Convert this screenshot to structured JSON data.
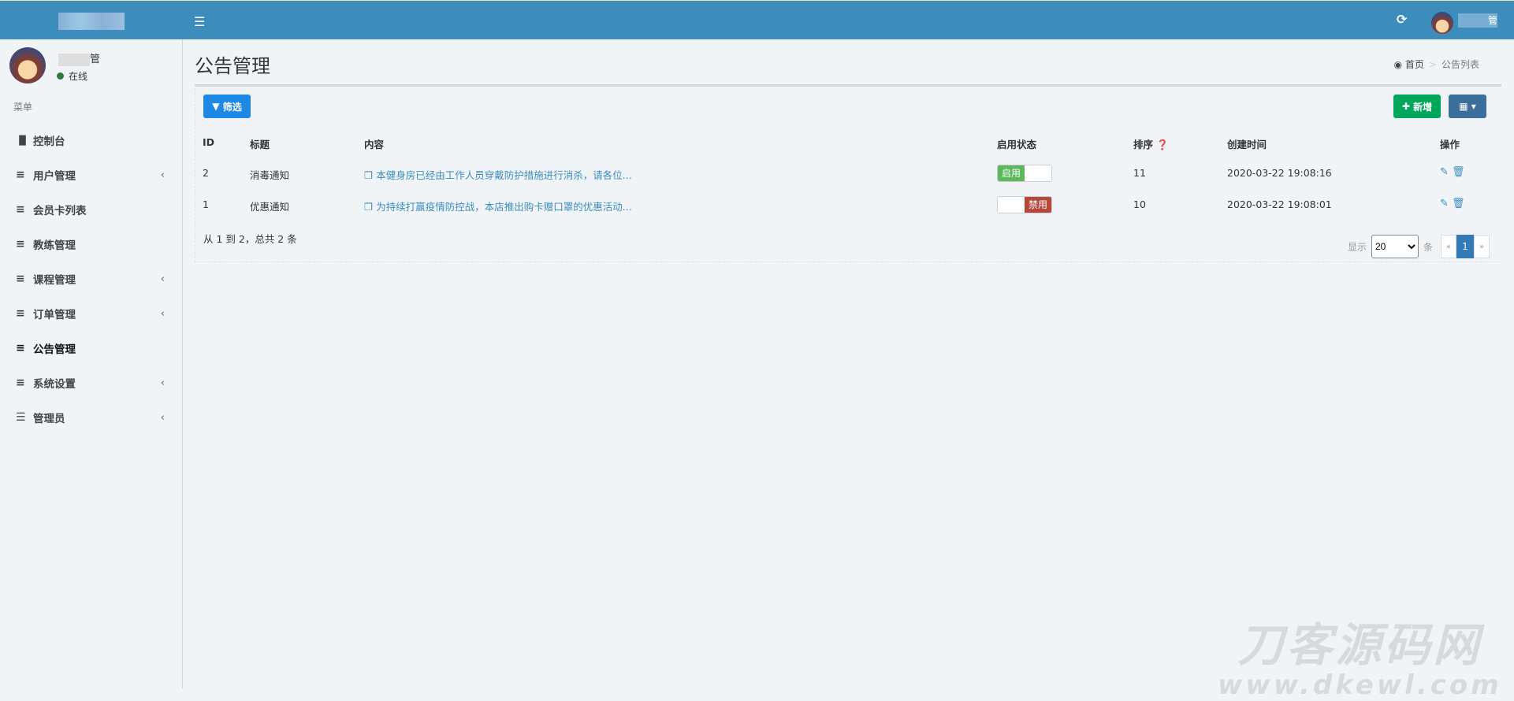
{
  "topbar": {
    "menu_icon": "hamburger-icon",
    "refresh_icon": "refresh-icon",
    "user_suffix": "管"
  },
  "sidebar": {
    "user": {
      "name_suffix": "管",
      "status": "在线"
    },
    "menu_header": "菜单",
    "items": [
      {
        "label": "控制台",
        "icon": "bar-chart-icon",
        "sub": false
      },
      {
        "label": "用户管理",
        "icon": "list-icon",
        "sub": true
      },
      {
        "label": "会员卡列表",
        "icon": "list-icon",
        "sub": false
      },
      {
        "label": "教练管理",
        "icon": "list-icon",
        "sub": false
      },
      {
        "label": "课程管理",
        "icon": "list-icon",
        "sub": true
      },
      {
        "label": "订单管理",
        "icon": "list-icon",
        "sub": true
      },
      {
        "label": "公告管理",
        "icon": "list-icon",
        "sub": false,
        "active": true
      },
      {
        "label": "系统设置",
        "icon": "list-icon",
        "sub": true
      },
      {
        "label": "管理员",
        "icon": "server-icon",
        "sub": true
      }
    ]
  },
  "page": {
    "title": "公告管理",
    "breadcrumb": {
      "home": "首页",
      "current": "公告列表"
    }
  },
  "toolbar": {
    "filter": "筛选",
    "add": "新增"
  },
  "table": {
    "headers": {
      "id": "ID",
      "title": "标题",
      "content": "内容",
      "status": "启用状态",
      "sort": "排序",
      "created": "创建时间",
      "actions": "操作"
    },
    "rows": [
      {
        "id": "2",
        "title": "消毒通知",
        "content": "本健身房已经由工作人员穿戴防护措施进行消杀，请各位...",
        "status": "启用",
        "enabled": true,
        "sort": "11",
        "created": "2020-03-22 19:08:16"
      },
      {
        "id": "1",
        "title": "优惠通知",
        "content": "为持续打赢疫情防控战，本店推出购卡赠口罩的优惠活动...",
        "status": "禁用",
        "enabled": false,
        "sort": "10",
        "created": "2020-03-22 19:08:01"
      }
    ]
  },
  "footer": {
    "summary": "从 1 到 2，总共 2 条",
    "show": "显示",
    "page_size": "20",
    "unit": "条",
    "prev": "«",
    "page": "1",
    "next": "»"
  },
  "watermark": {
    "line1": "刀客源码网",
    "line2": "www.dkewl.com"
  },
  "colors": {
    "topbar": "#3c8dbc",
    "add": "#00a65a",
    "filter": "#1e88e5",
    "enabled": "#5cb85c",
    "disabled": "#b5483b"
  }
}
